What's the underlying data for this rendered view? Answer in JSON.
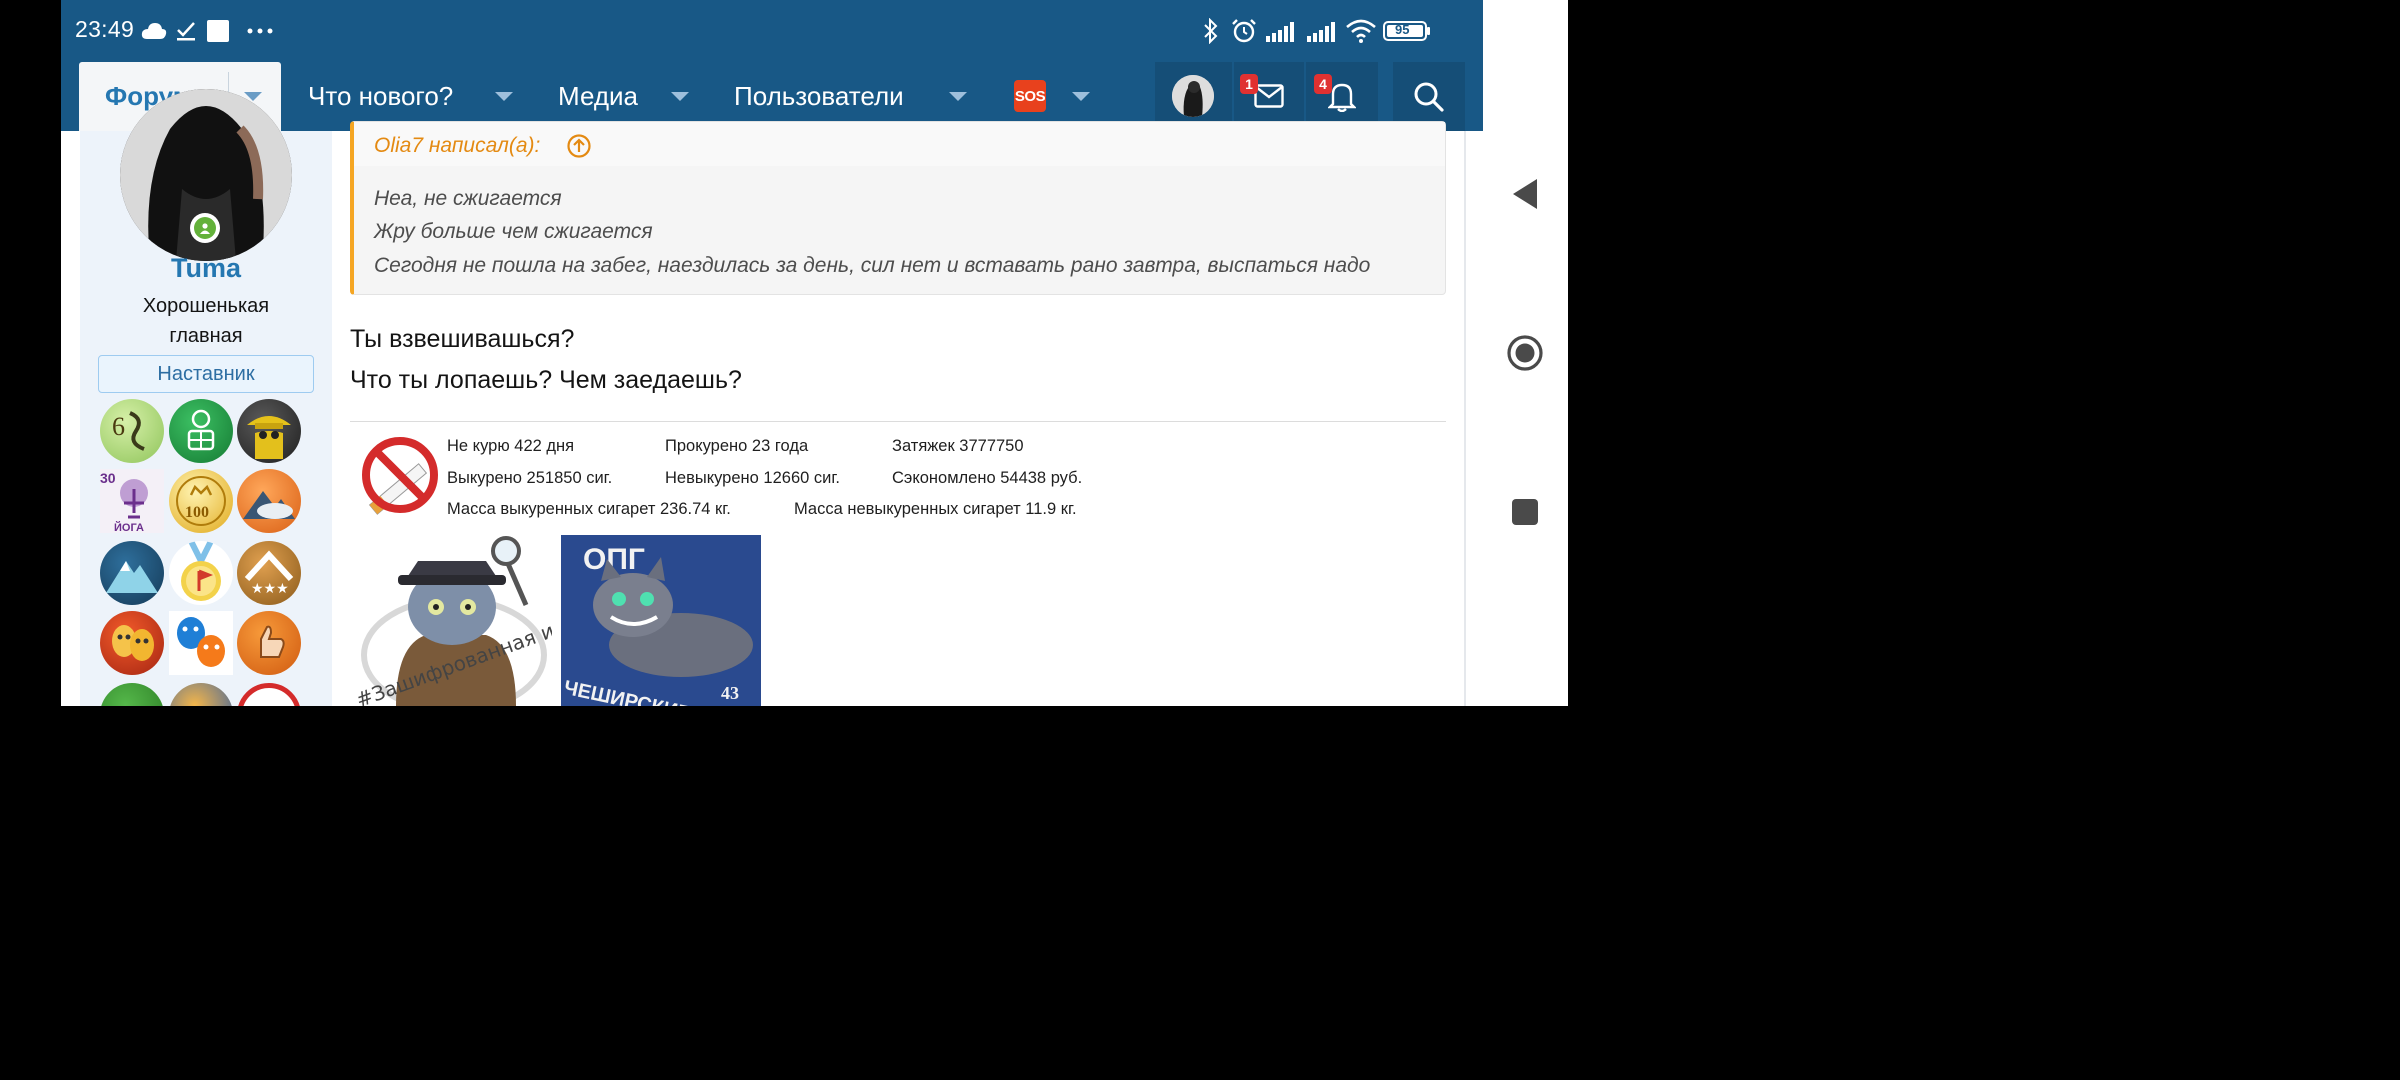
{
  "status_bar": {
    "time": "23:49",
    "battery": "95",
    "icons": [
      "cloud-icon",
      "check-icon",
      "square-icon",
      "more-icon",
      "bluetooth-icon",
      "alarm-icon",
      "signal-icon",
      "signal-icon",
      "wifi-icon",
      "battery-icon"
    ]
  },
  "nav": {
    "active_tab": "Форумы",
    "items": [
      "Что нового?",
      "Медиа",
      "Пользователи"
    ],
    "sos_label": "SOS",
    "messages_count": "1",
    "alerts_count": "4"
  },
  "user": {
    "name": "Tuma",
    "title_line1": "Хорошенькая",
    "title_line2": "главная",
    "banner": "Наставник",
    "trophy_labels": [
      "6",
      "30",
      "ЙОГА",
      "100"
    ]
  },
  "quote": {
    "author": "Olia7 написал(а):",
    "lines": [
      "Неа, не сжигается",
      "Жру больше чем сжигается",
      "Сегодня не пошла на забег, наездилась за день, сил нет и вставать рано завтра, выспаться надо"
    ]
  },
  "post": {
    "lines": [
      "Ты взвешивашься?",
      "Что ты лопаешь? Чем заедаешь?"
    ]
  },
  "signature": {
    "row1": [
      "Не курю 422 дня",
      "Прокурено 23 года",
      "Затяжек 3777750"
    ],
    "row2": [
      "Выкурено 251850 сиг.",
      "Невыкурено 12660 сиг.",
      "Сэкономлено 54438 руб."
    ],
    "row3": [
      "Масса выкуренных сигарет 236.74 кг.",
      "Масса невыкуренных сигарет 11.9 кг."
    ],
    "image2_title": "ОПГ",
    "image2_caption": "ЧЕШИРСКИЕ КОТЫ",
    "image2_number": "43",
    "image1_caption": "#Зашифрованная игра"
  },
  "colors": {
    "header_bg": "#185886",
    "link_blue": "#2577b1",
    "quote_accent": "#f5a623",
    "badge_red": "#e03131",
    "online_green": "#63b13a"
  }
}
